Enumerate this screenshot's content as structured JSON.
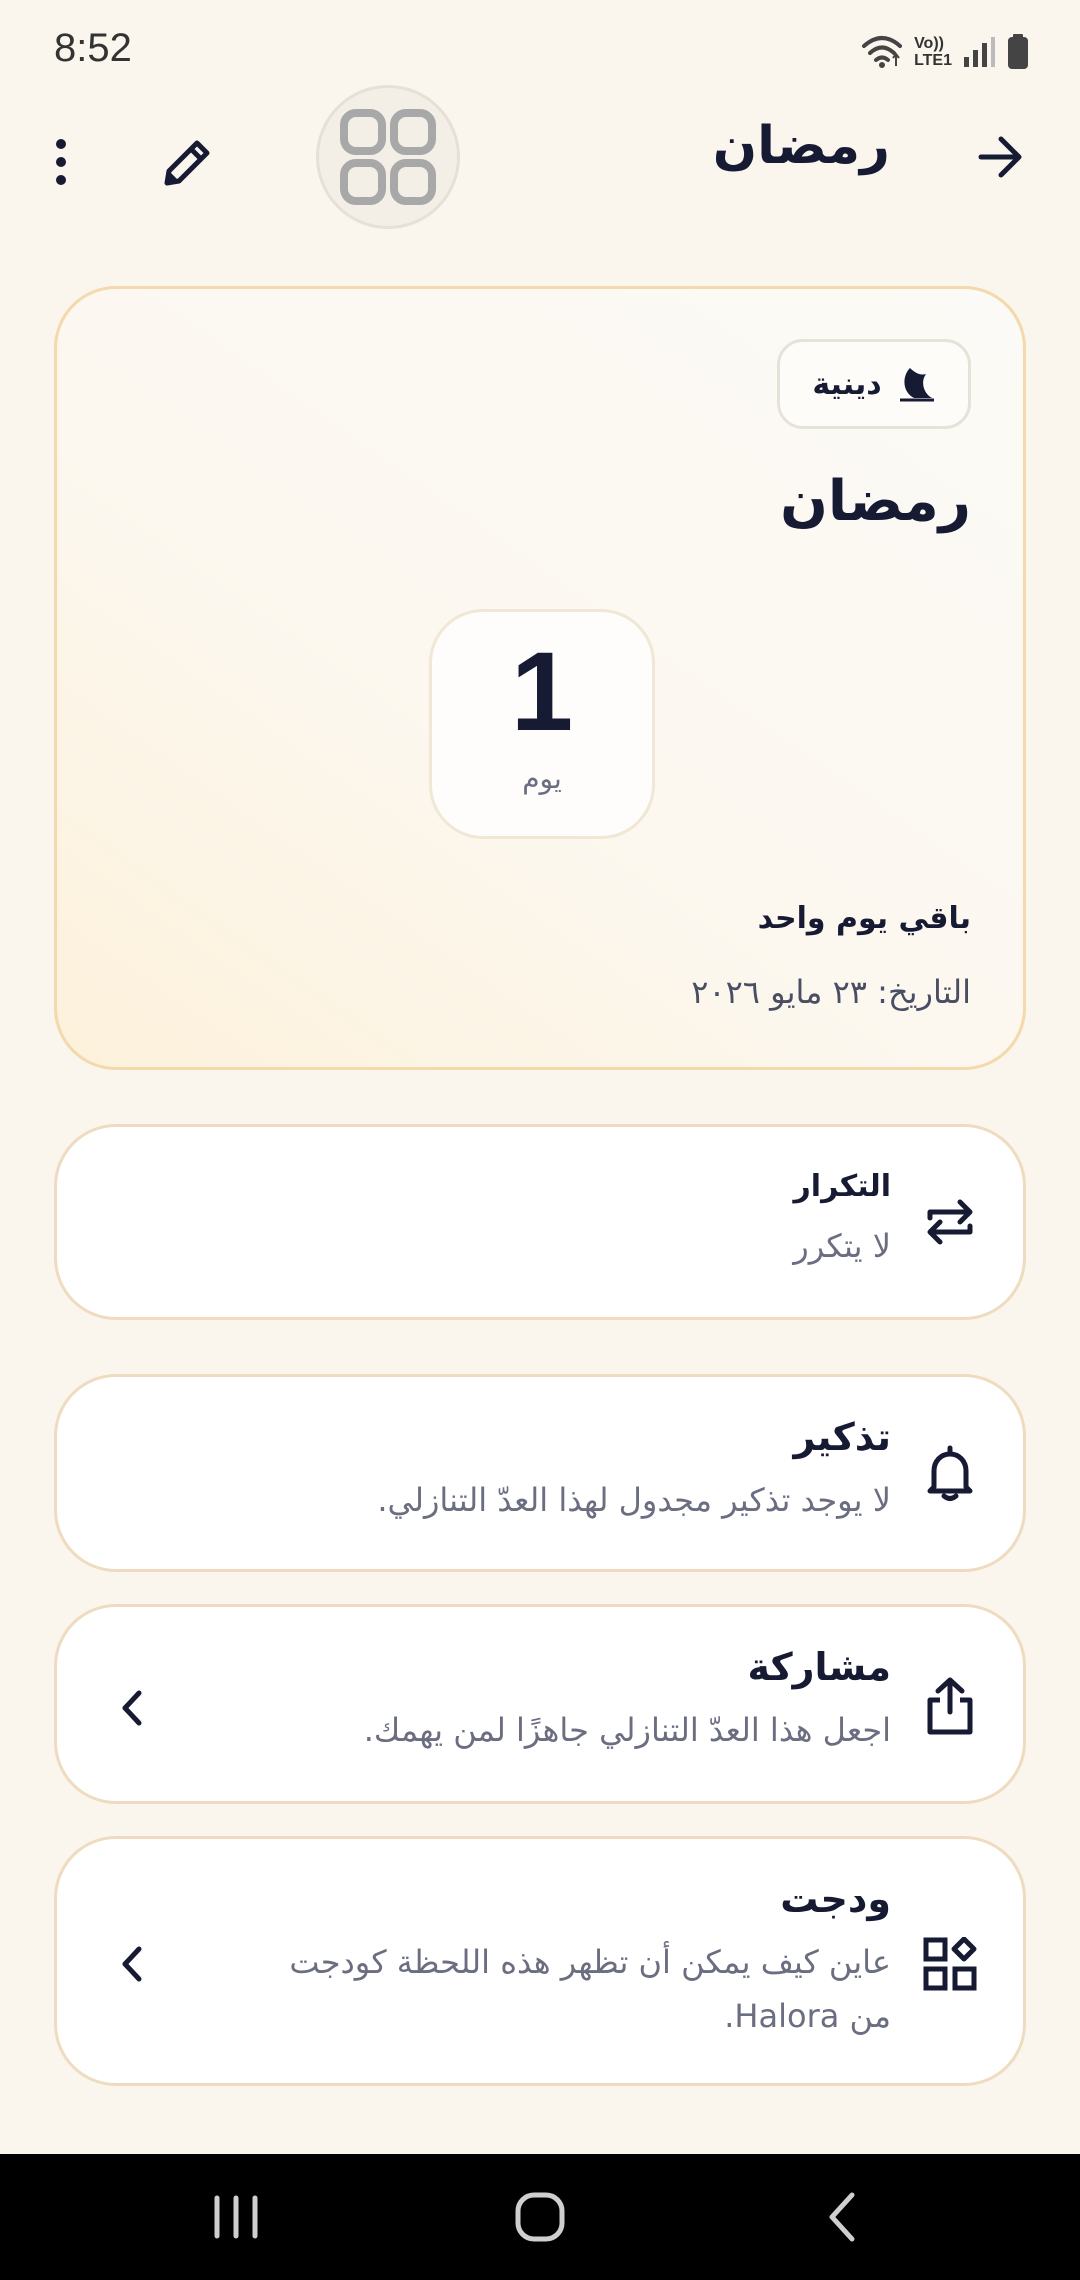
{
  "status_bar": {
    "time": "8:52",
    "network_label_top": "Vo))",
    "network_label_bottom": "LTE1",
    "icons": [
      "wifi-icon",
      "signal-icon",
      "battery-icon"
    ]
  },
  "header": {
    "title": "رمضان",
    "icons": [
      "back-arrow-icon",
      "widget-grid-icon",
      "edit-pencil-icon",
      "more-vertical-icon"
    ]
  },
  "hero": {
    "category_badge": "دينية",
    "category_icon": "moon-icon",
    "title": "رمضان",
    "count": "1",
    "unit": "يوم",
    "remaining": "باقي يوم واحد",
    "date": "التاريخ: ٢٣ مايو ٢٠٢٦"
  },
  "rows": {
    "repeat": {
      "title": "التكرار",
      "subtitle": "لا يتكرر",
      "icon": "repeat-icon"
    },
    "reminder": {
      "title": "تذكير",
      "subtitle": "لا يوجد تذكير مجدول لهذا العدّ التنازلي.",
      "icon": "bell-icon"
    },
    "share": {
      "title": "مشاركة",
      "subtitle": "اجعل هذا العدّ التنازلي جاهزًا لمن يهمك.",
      "icon": "share-icon"
    },
    "widget": {
      "title": "ودجت",
      "subtitle": "عاين كيف يمكن أن تظهر هذه اللحظة كودجت من Halora.",
      "icon": "widgets-icon"
    }
  },
  "colors": {
    "background": "#faf6ee",
    "text_primary": "#161a33",
    "text_secondary": "#6b6e80",
    "card_border": "#efdcc0",
    "hero_gradient_warm": "#fdf1db"
  },
  "nav_bar": {
    "buttons": [
      "recent-apps-icon",
      "home-icon",
      "back-icon"
    ]
  }
}
